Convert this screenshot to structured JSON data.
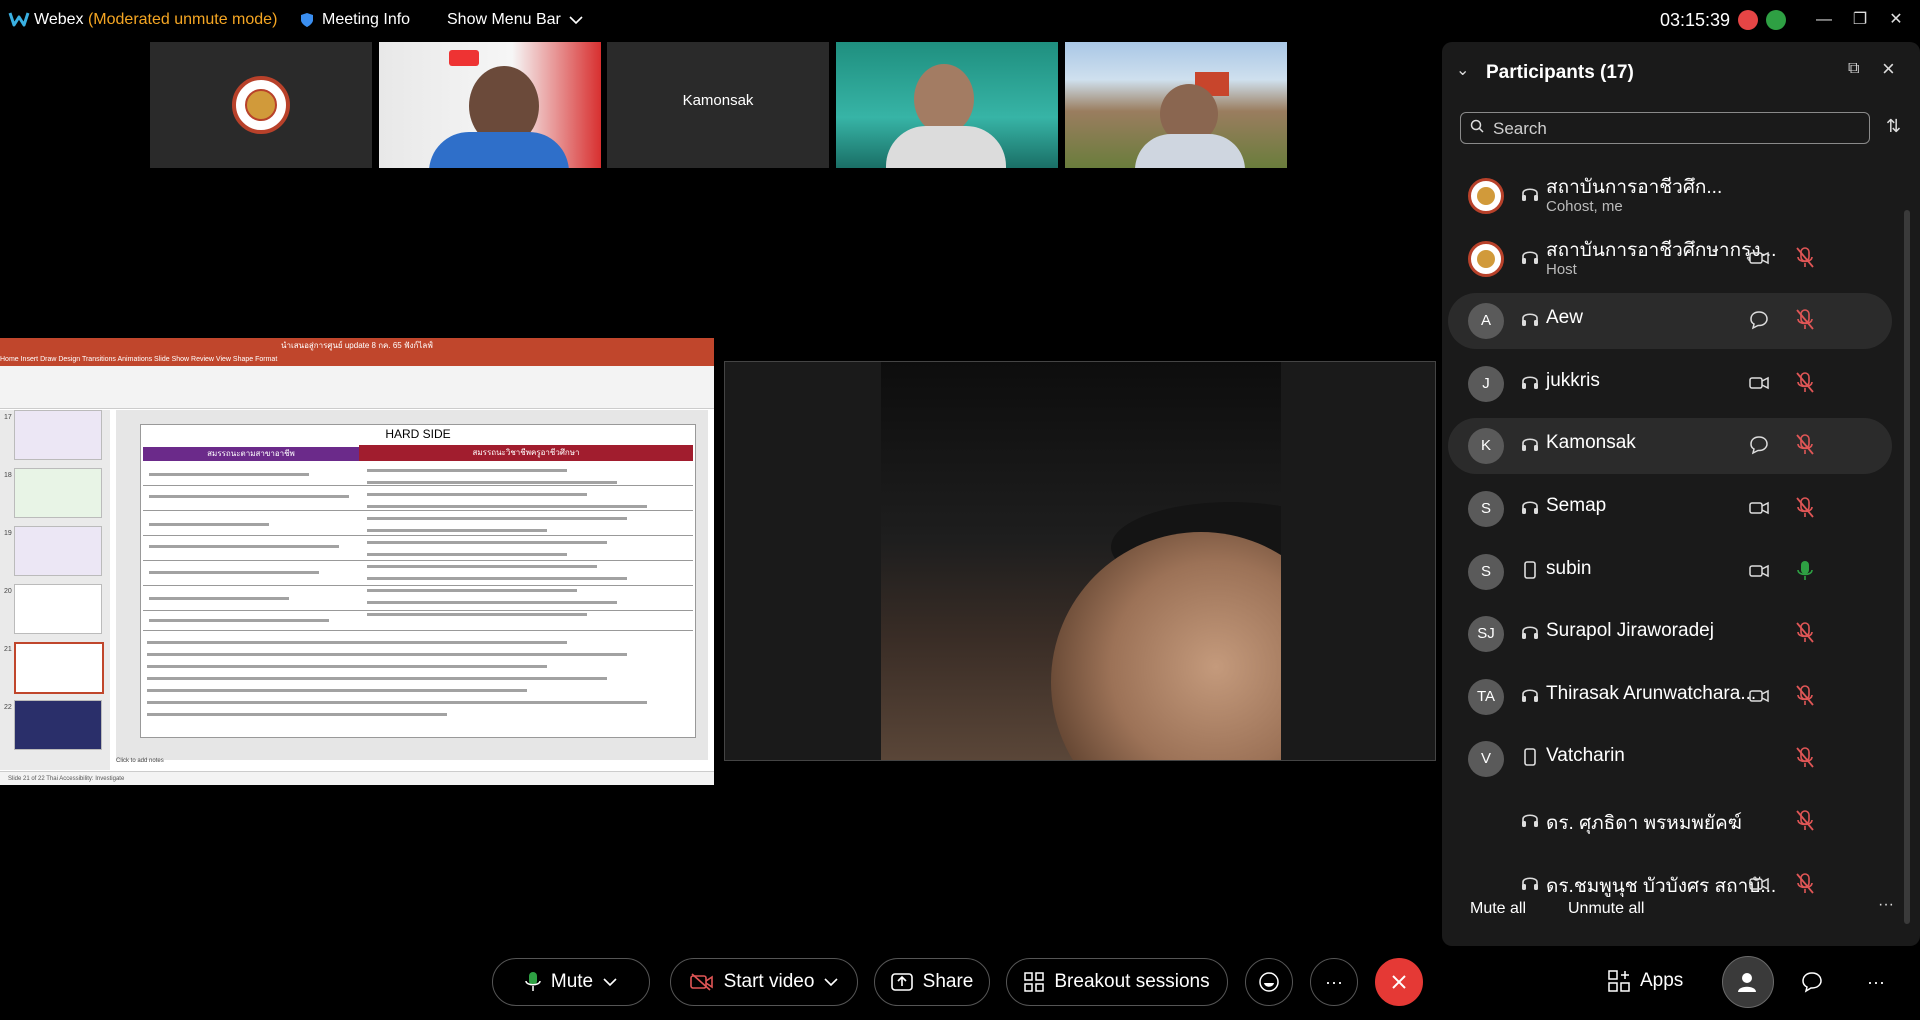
{
  "titlebar": {
    "app_name": "Webex",
    "mode": "(Moderated unmute mode)",
    "meeting_info": "Meeting Info",
    "show_menu": "Show Menu Bar",
    "clock": "03:15:39"
  },
  "thumbnails": [
    {
      "label": "",
      "kind": "seal"
    },
    {
      "label": "",
      "kind": "video-person-scg"
    },
    {
      "label": "Kamonsak",
      "kind": "name-only"
    },
    {
      "label": "",
      "kind": "video-person-banner"
    },
    {
      "label": "",
      "kind": "video-person-field"
    }
  ],
  "slide": {
    "window_title": "นำเสนอสู่การศูนย์ update 8 กค. 65 ฟังก์ไลฟ์",
    "ribbon_tabs": "Home  Insert  Draw  Design  Transitions  Animations  Slide Show  Review  View  Shape Format",
    "page_title": "HARD SIDE",
    "left_header": "สมรรถนะตามสาขาอาชีพ",
    "right_header": "สมรรถนะวิชาชีพครูอาชีวศึกษา",
    "thumb_numbers": [
      "17",
      "18",
      "19",
      "20",
      "21",
      "22"
    ],
    "click_notes": "Click to add notes",
    "status": "Slide 21 of 22   Thai   Accessibility: Investigate"
  },
  "panel": {
    "title": "Participants (17)",
    "search_placeholder": "Search",
    "mute_all": "Mute all",
    "unmute_all": "Unmute all",
    "participants": [
      {
        "name": "สถาบันการอาชีวศึก...",
        "role": "Cohost, me",
        "initials": "",
        "avatar": "seal",
        "action": "",
        "mic": ""
      },
      {
        "name": "สถาบันการอาชีวศึกษากรุง...",
        "role": "Host",
        "initials": "",
        "avatar": "seal",
        "action": "video",
        "mic": "muted"
      },
      {
        "name": "Aew",
        "role": "",
        "initials": "A",
        "avatar": "initial",
        "action": "chat",
        "mic": "muted"
      },
      {
        "name": "jukkris",
        "role": "",
        "initials": "J",
        "avatar": "initial",
        "action": "video",
        "mic": "muted"
      },
      {
        "name": "Kamonsak",
        "role": "",
        "initials": "K",
        "avatar": "initial",
        "action": "chat",
        "mic": "muted"
      },
      {
        "name": "Semap",
        "role": "",
        "initials": "S",
        "avatar": "initial",
        "action": "video",
        "mic": "muted"
      },
      {
        "name": "subin",
        "role": "",
        "initials": "S",
        "avatar": "initial",
        "action": "video",
        "mic": "active"
      },
      {
        "name": "Surapol Jiraworadej",
        "role": "",
        "initials": "SJ",
        "avatar": "initial",
        "action": "",
        "mic": "muted"
      },
      {
        "name": "Thirasak Arunwatchara...",
        "role": "",
        "initials": "TA",
        "avatar": "initial",
        "action": "video",
        "mic": "muted"
      },
      {
        "name": "Vatcharin",
        "role": "",
        "initials": "V",
        "avatar": "initial",
        "action": "",
        "mic": "muted"
      },
      {
        "name": "ดร. ศุภธิดา พรหมพยัคฆ์",
        "role": "",
        "initials": "",
        "avatar": "none",
        "action": "",
        "mic": "muted"
      },
      {
        "name": "ดร.ชมพูนุช บัวบังศร สถาบั...",
        "role": "",
        "initials": "",
        "avatar": "none",
        "action": "video",
        "mic": "muted"
      }
    ]
  },
  "toolbar": {
    "mute": "Mute",
    "start_video": "Start video",
    "share": "Share",
    "breakout": "Breakout sessions",
    "apps": "Apps"
  },
  "colors": {
    "mode_accent": "#f5a623",
    "end_call": "#e53935",
    "mic_active": "#2ea043",
    "mic_muted": "#e05656"
  }
}
